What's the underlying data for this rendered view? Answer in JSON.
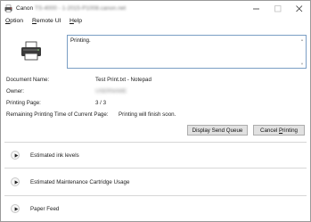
{
  "window": {
    "title_prefix": "Canon",
    "title_blurred": "TS-4000 - 1-2015-P1008.canon.net"
  },
  "menu": [
    {
      "label": "Option",
      "key": "O"
    },
    {
      "label": "Remote UI",
      "key": "R"
    },
    {
      "label": "Help",
      "key": "H"
    }
  ],
  "status": {
    "message": "Printing."
  },
  "info": {
    "document_name_label": "Document Name:",
    "document_name_value": "Test Print.txt - Notepad",
    "owner_label": "Owner:",
    "owner_value": "USERNAME",
    "printing_page_label": "Printing Page:",
    "printing_page_value": "3 / 3",
    "remaining_label": "Remaining Printing Time of Current Page:",
    "remaining_value": "Printing will finish soon."
  },
  "buttons": {
    "display_send_queue": "Display Send Queue",
    "cancel_printing_pre": "Cancel ",
    "cancel_printing_key": "P",
    "cancel_printing_post": "rinting"
  },
  "sections": [
    {
      "label": "Estimated ink levels"
    },
    {
      "label": "Estimated Maintenance Cartridge Usage"
    },
    {
      "label": "Paper Feed"
    }
  ],
  "colors": {
    "status_border": "#7a9ec4",
    "button_bg": "#e1e1e1",
    "accent_red": "#d9342b"
  },
  "icons": {
    "app": "canon-printer-icon",
    "printer": "printer-icon",
    "expand": "play-icon"
  }
}
